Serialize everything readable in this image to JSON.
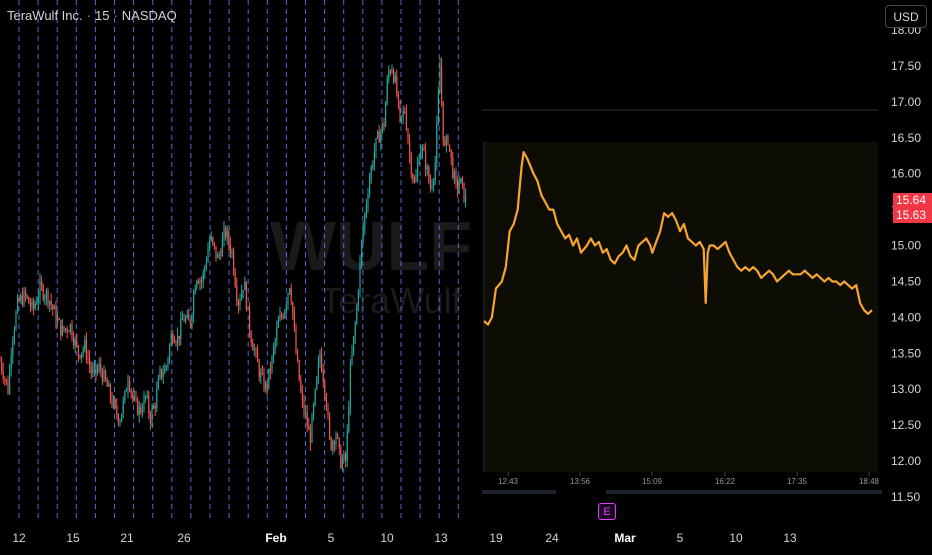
{
  "header": {
    "company": "TeraWulf Inc.",
    "interval": "15",
    "exchange": "NASDAQ",
    "separator": "·"
  },
  "currency_button": "USD",
  "watermark": {
    "ticker": "WULF",
    "name": "TeraWulf"
  },
  "price_tags": {
    "upper": "15.64",
    "lower": "15.63"
  },
  "earnings_badge": "E",
  "colors": {
    "background": "#000000",
    "grid_dash": "#5c7cfa",
    "candle_up": "#26a69a",
    "candle_down": "#ef5350",
    "line": "#f7a531",
    "price_tag": "#f23645",
    "earnings": "#e040fb"
  },
  "chart_data": [
    {
      "type": "candlestick",
      "title": "TeraWulf Inc. · 15 · NASDAQ",
      "x_tick_labels": [
        "12",
        "15",
        "21",
        "26",
        "Feb",
        "5",
        "10",
        "13",
        "19",
        "24",
        "Mar",
        "5",
        "10",
        "13"
      ],
      "y_tick_labels": [
        "18.00",
        "17.50",
        "17.00",
        "16.50",
        "16.00",
        "15.50",
        "15.00",
        "14.50",
        "14.00",
        "13.50",
        "13.00",
        "12.50",
        "12.00",
        "11.50"
      ],
      "ylim": [
        11.5,
        18.0
      ],
      "grid": "dashed vertical lines",
      "path_x": [
        0,
        4,
        8,
        12,
        18,
        25,
        33,
        40,
        48,
        56,
        62,
        70,
        78,
        85,
        92,
        100,
        108,
        115,
        120,
        125,
        128,
        134,
        140,
        146,
        150,
        155,
        160,
        166,
        172,
        178,
        183,
        190,
        196,
        202,
        210,
        218,
        225,
        232,
        238,
        244,
        250,
        255,
        260,
        266,
        272,
        278,
        284,
        290,
        296,
        302,
        306,
        310,
        316,
        320,
        326,
        330,
        336,
        340,
        346,
        350,
        356,
        362,
        368,
        374,
        378,
        384,
        388,
        392,
        396,
        400,
        405,
        410,
        415,
        420,
        425,
        430,
        435,
        440,
        444,
        448,
        452,
        456,
        460,
        464,
        467
      ],
      "path_y": [
        13.4,
        13.2,
        13.0,
        13.7,
        14.2,
        14.3,
        14.1,
        14.4,
        14.3,
        14.0,
        13.8,
        13.9,
        13.5,
        13.6,
        13.2,
        13.3,
        13.0,
        12.7,
        12.6,
        12.9,
        13.2,
        12.8,
        12.7,
        12.9,
        12.6,
        12.8,
        13.2,
        13.3,
        13.8,
        13.7,
        14.0,
        13.9,
        14.6,
        14.5,
        15.1,
        14.8,
        15.2,
        14.9,
        14.2,
        14.5,
        13.8,
        13.5,
        13.2,
        13.0,
        13.4,
        13.9,
        14.1,
        14.5,
        13.5,
        12.8,
        12.6,
        12.3,
        13.0,
        13.5,
        12.9,
        12.2,
        12.4,
        12.0,
        12.0,
        13.2,
        14.0,
        15.1,
        15.8,
        16.3,
        16.5,
        16.7,
        17.4,
        17.5,
        17.2,
        16.7,
        16.9,
        16.2,
        15.8,
        16.4,
        16.2,
        15.8,
        16.1,
        17.5,
        16.3,
        16.5,
        16.1,
        15.8,
        15.9,
        15.7,
        15.6
      ]
    },
    {
      "type": "line",
      "x_tick_labels": [
        "12:43",
        "13:56",
        "15:09",
        "16:22",
        "17:35",
        "18:48"
      ],
      "x": [
        0,
        4,
        8,
        12,
        18,
        22,
        26,
        30,
        34,
        36,
        38,
        40,
        44,
        50,
        54,
        58,
        62,
        66,
        70,
        74,
        78,
        82,
        86,
        90,
        94,
        98,
        104,
        108,
        112,
        116,
        120,
        124,
        128,
        132,
        136,
        140,
        144,
        148,
        152,
        156,
        160,
        164,
        168,
        170,
        174,
        178,
        182,
        186,
        190,
        194,
        198,
        202,
        206,
        210,
        214,
        218,
        222,
        224,
        226,
        228,
        232,
        236,
        240,
        244,
        248,
        252,
        256,
        260,
        264,
        268,
        272,
        276,
        280,
        284,
        288,
        292,
        296,
        300,
        304,
        308,
        312,
        316,
        320,
        324,
        328,
        332,
        336,
        340,
        344,
        348,
        352,
        356,
        360,
        364,
        368,
        372,
        376,
        380,
        384,
        388,
        392
      ],
      "y": [
        13.95,
        13.9,
        14.0,
        14.4,
        14.5,
        14.7,
        15.2,
        15.3,
        15.5,
        15.8,
        16.1,
        16.3,
        16.2,
        16.0,
        15.9,
        15.7,
        15.6,
        15.5,
        15.5,
        15.3,
        15.2,
        15.1,
        15.15,
        15.0,
        15.1,
        14.9,
        15.0,
        15.1,
        15.0,
        15.05,
        14.9,
        14.95,
        14.8,
        14.75,
        14.85,
        14.9,
        15.0,
        14.85,
        14.8,
        15.0,
        15.05,
        15.1,
        15.0,
        14.9,
        15.05,
        15.2,
        15.45,
        15.4,
        15.45,
        15.35,
        15.2,
        15.3,
        15.1,
        15.05,
        15.0,
        15.05,
        14.95,
        14.2,
        14.9,
        15.0,
        15.0,
        14.95,
        15.0,
        15.05,
        14.9,
        14.8,
        14.7,
        14.65,
        14.7,
        14.65,
        14.7,
        14.65,
        14.55,
        14.6,
        14.65,
        14.6,
        14.5,
        14.55,
        14.6,
        14.65,
        14.6,
        14.6,
        14.6,
        14.65,
        14.6,
        14.55,
        14.6,
        14.55,
        14.5,
        14.55,
        14.5,
        14.5,
        14.45,
        14.5,
        14.45,
        14.4,
        14.45,
        14.2,
        14.1,
        14.05,
        14.1
      ]
    }
  ]
}
